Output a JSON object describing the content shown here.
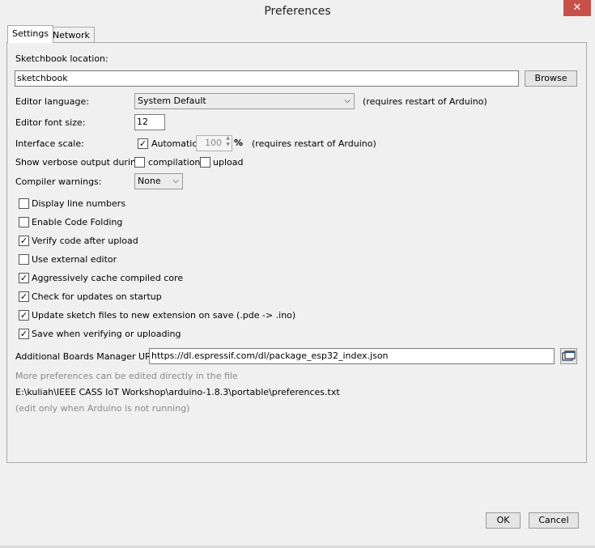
{
  "window": {
    "title": "Preferences",
    "close_glyph": "✕"
  },
  "tabs": [
    {
      "label": "Settings",
      "active": true
    },
    {
      "label": "Network",
      "active": false
    }
  ],
  "settings": {
    "sketchbook": {
      "label": "Sketchbook location:",
      "value": "sketchbook",
      "browse_label": "Browse"
    },
    "editor_language": {
      "label": "Editor language:",
      "value": "System Default",
      "note": "(requires restart of Arduino)"
    },
    "editor_font_size": {
      "label": "Editor font size:",
      "value": "12"
    },
    "interface_scale": {
      "label": "Interface scale:",
      "automatic_label": "Automatic",
      "automatic_checked": true,
      "value": "100",
      "unit": "%",
      "note": "(requires restart of Arduino)"
    },
    "verbose": {
      "label": "Show verbose output during:",
      "compilation_label": "compilation",
      "compilation_checked": false,
      "upload_label": "upload",
      "upload_checked": false
    },
    "compiler_warnings": {
      "label": "Compiler warnings:",
      "value": "None"
    },
    "options": [
      {
        "label": "Display line numbers",
        "checked": false
      },
      {
        "label": "Enable Code Folding",
        "checked": false
      },
      {
        "label": "Verify code after upload",
        "checked": true
      },
      {
        "label": "Use external editor",
        "checked": false
      },
      {
        "label": "Aggressively cache compiled core",
        "checked": true
      },
      {
        "label": "Check for updates on startup",
        "checked": true
      },
      {
        "label": "Update sketch files to new extension on save (.pde -> .ino)",
        "checked": true
      },
      {
        "label": "Save when verifying or uploading",
        "checked": true
      }
    ],
    "boards_urls": {
      "label": "Additional Boards Manager URLs:",
      "value": "https://dl.espressif.com/dl/package_esp32_index.json"
    },
    "more_prefs_note": "More preferences can be edited directly in the file",
    "prefs_path": "E:\\kuliah\\IEEE CASS IoT Workshop\\arduino-1.8.3\\portable\\preferences.txt",
    "edit_note": "(edit only when Arduino is not running)"
  },
  "footer": {
    "ok_label": "OK",
    "cancel_label": "Cancel"
  },
  "icons": {
    "check": "✓",
    "chevron_down": "⌵",
    "spin_up": "▲",
    "spin_down": "▼",
    "window_icon": "window-list-icon",
    "dropdown": "chevron-down-icon"
  }
}
